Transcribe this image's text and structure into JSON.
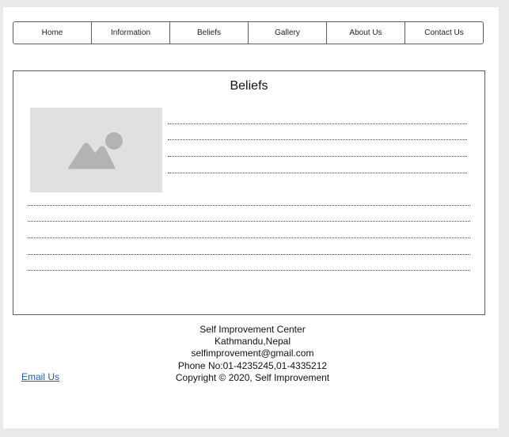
{
  "nav": {
    "items": [
      "Home",
      "Information",
      "Beliefs",
      "Gallery",
      "About Us",
      "Contact Us"
    ]
  },
  "section": {
    "title": "Beliefs",
    "image_icon": "image-placeholder-icon"
  },
  "footer": {
    "lines": [
      "Self Improvement Center",
      "Kathmandu,Nepal",
      "selfimprovement@gmail.com",
      "Phone No:01-4235245,01-4335212",
      "Copyright © 2020, Self Improvement"
    ],
    "email_link": "Email Us"
  },
  "colors": {
    "link": "#1a5fb4",
    "placeholder_bg": "#e0e0e0",
    "placeholder_icon": "#b3b3b3"
  }
}
